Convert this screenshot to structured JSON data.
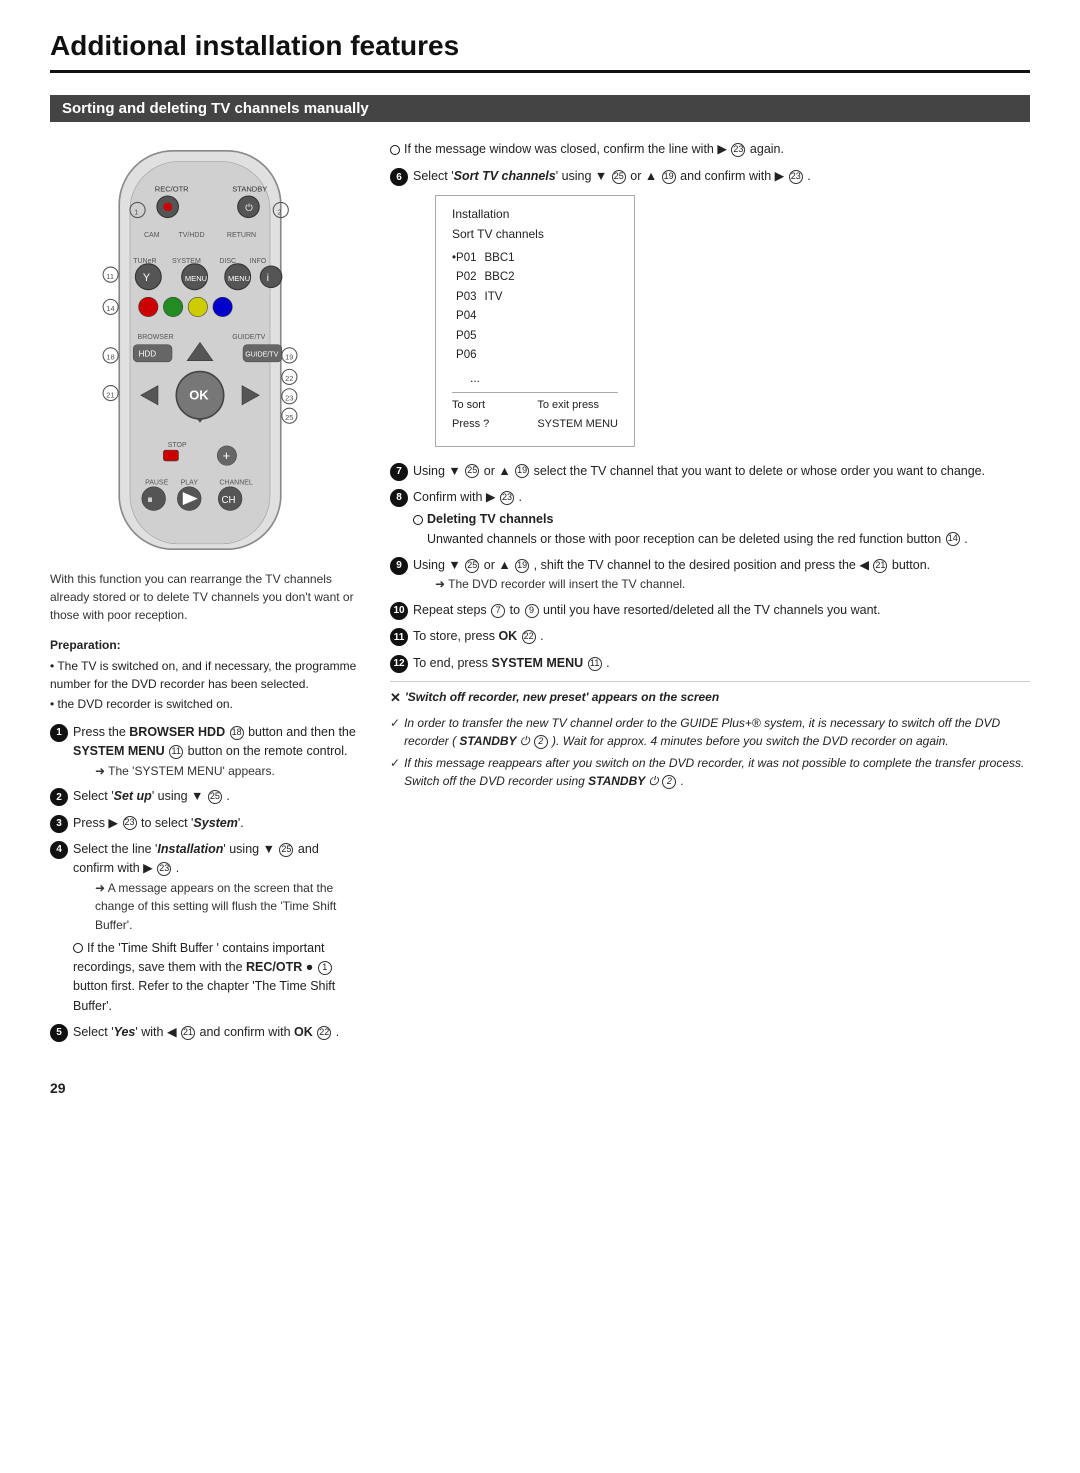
{
  "page": {
    "title": "Additional installation features",
    "page_number": "29"
  },
  "section": {
    "title": "Sorting and deleting TV channels manually"
  },
  "intro": {
    "text": "With this function you can rearrange the TV channels already stored or to delete TV channels you don't want or those with poor reception."
  },
  "preparation": {
    "label": "Preparation:",
    "lines": [
      "• The TV is switched on, and if necessary, the programme number for the DVD recorder has been selected.",
      "• the DVD recorder is switched on."
    ]
  },
  "steps_left": [
    {
      "num": "1",
      "filled": true,
      "text": "Press the  BROWSER HDD ⑱ button and then the  SYSTEM MENU ⑪ button on the remote control.",
      "arrow": "The 'SYSTEM MENU' appears."
    },
    {
      "num": "2",
      "filled": true,
      "text": "Select 'Set up' using ▼ ㉕ .",
      "arrow": null
    },
    {
      "num": "3",
      "filled": true,
      "text": "Press ▶ ㉓ to select 'System'.",
      "arrow": null
    },
    {
      "num": "4",
      "filled": true,
      "text": "Select the line 'Installation' using ▼ ㉕ and confirm with ▶ ㉓ .",
      "arrow": "A message appears on the screen that the change of this setting will flush the 'Time Shift Buffer'.",
      "circle_note": "If the 'Time Shift Buffer ' contains important recordings, save them with the REC/OTR ● ① button first. Refer to the chapter 'The Time Shift Buffer'."
    },
    {
      "num": "5",
      "filled": true,
      "text": "Select 'Yes' with ◀ ㉑ and confirm with  OK ㉒ ."
    }
  ],
  "steps_right": [
    {
      "circle_note": "If the message window was closed, confirm the line with ▶ ㉓ again."
    },
    {
      "num": "6",
      "filled": true,
      "text": "Select 'Sort TV channels' using ▼ ㉕ or ▲ ⑲ and confirm with ▶ ㉓ ."
    },
    {
      "screen": {
        "title": "Installation",
        "subtitle": "Sort TV channels",
        "items": [
          {
            "code": "P01",
            "name": "BBC1"
          },
          {
            "code": "P02",
            "name": "BBC2"
          },
          {
            "code": "P03",
            "name": "ITV"
          },
          {
            "code": "P04",
            "name": ""
          },
          {
            "code": "P05",
            "name": ""
          },
          {
            "code": "P06",
            "name": ""
          }
        ],
        "ellipsis": "...",
        "bottom_left": "To sort\nPress ?",
        "bottom_right": "To exit press\nSYSTEM MENU"
      }
    },
    {
      "num": "7",
      "filled": true,
      "text": "Using ▼ ㉕ or ▲ ⑲ select the TV channel that you want to delete or whose order you want to change."
    },
    {
      "num": "8",
      "filled": true,
      "text": "Confirm with ▶ ㉓ .",
      "sub_bold": "Deleting TV channels",
      "sub_text": "Unwanted channels or those with poor reception can be deleted using the red function button ⑭ ."
    },
    {
      "num": "9",
      "filled": true,
      "text": "Using ▼ ㉕ or ▲ ⑲ , shift the TV channel to the desired position and press the ◀ ㉑ button.",
      "arrow": "The DVD recorder will insert the TV channel."
    },
    {
      "num": "10",
      "filled": true,
      "text": "Repeat steps ⑦ to ⑨ until you have resorted/deleted all the TV channels you want."
    },
    {
      "num": "11",
      "filled": true,
      "text": "To store, press  OK ㉒ ."
    },
    {
      "num": "12",
      "filled": true,
      "text": "To end, press  SYSTEM MENU ⑪ ."
    },
    {
      "cross_note": "'Switch off recorder, new preset' appears on the screen",
      "check_notes": [
        "In order to transfer the new TV channel order to the GUIDE Plus+® system, it is necessary to switch off the DVD recorder ( STANDBY ⏻ ② ). Wait for approx. 4 minutes before you switch the DVD recorder on again.",
        "If this message reappears after you switch on the DVD recorder, it was not possible to complete the transfer process. Switch off the DVD recorder using  STANDBY ⏻ ② ."
      ]
    }
  ],
  "remote_labels": {
    "rec_otr": "REC/OTR",
    "standby": "STANDBY",
    "cam": "CAM",
    "tv_hdd": "TV/HDD",
    "return": "RETURN",
    "tuner": "TUNeR",
    "system": "SYSTEM",
    "disc": "DISC",
    "info": "INFO",
    "browser": "BROWSER",
    "guide_tv": "GUIDE/TV",
    "hdd": "HDD",
    "stop": "STOP",
    "pause": "PAUSE",
    "play": "PLAY",
    "channel": "CHANNEL",
    "numbers": [
      "1",
      "2",
      "11",
      "14",
      "18",
      "19",
      "21",
      "22",
      "23",
      "25"
    ]
  }
}
